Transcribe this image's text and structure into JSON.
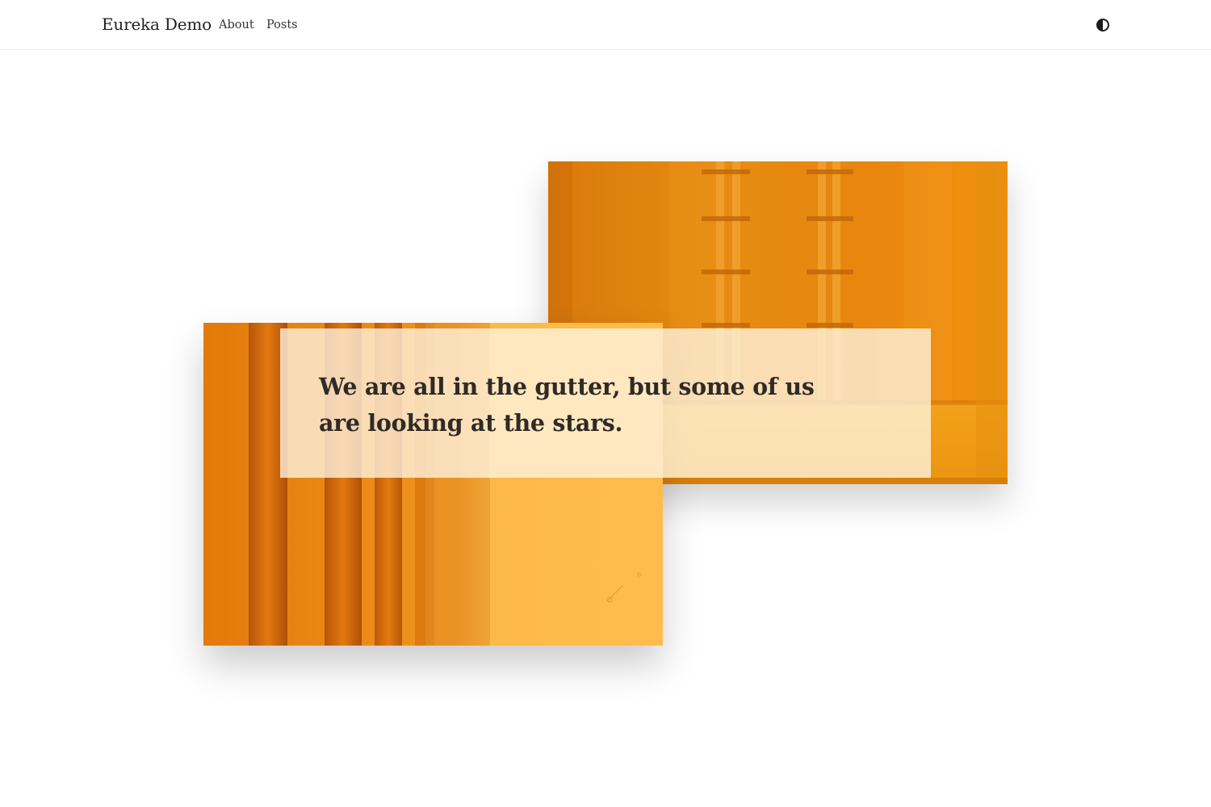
{
  "header": {
    "brand": "Eureka Demo",
    "nav": [
      {
        "label": "About"
      },
      {
        "label": "Posts"
      }
    ],
    "theme_toggle_icon": "contrast-half-circle-icon"
  },
  "hero": {
    "quote": "We are all in the gutter, but some of us are looking at the stars.",
    "back_photo": {
      "subject": "orange wall with pipes and brackets",
      "dominant_color": "#e08a0f"
    },
    "front_photo": {
      "subject": "orange vertical pipes against yellow wall",
      "dominant_color": "#f5a93a"
    }
  }
}
